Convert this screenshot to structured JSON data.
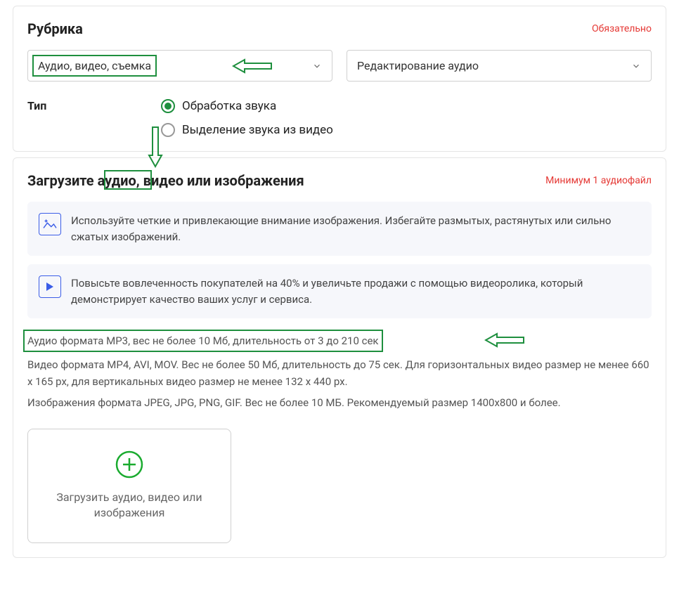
{
  "rubric": {
    "title": "Рубрика",
    "required_label": "Обязательно",
    "dropdown1": "Аудио, видео, съемка",
    "dropdown2": "Редактирование аудио"
  },
  "type": {
    "label": "Тип",
    "options": [
      "Обработка звука",
      "Выделение звука из видео"
    ],
    "selected": 0
  },
  "upload": {
    "title": "Загрузите аудио, видео или изображения",
    "min_label": "Минимум 1 аудиофайл",
    "info1": "Используйте четкие и привлекающие внимание изображения. Избегайте размытых, растянутых или сильно сжатых изображений.",
    "info2": "Повысьте вовлеченность покупателей на 40% и увеличьте продажи с помощью видеоролика, который демонстрирует качество ваших услуг и сервиса.",
    "spec_audio": "Аудио формата MP3, вес не более 10 Мб, длительность от 3 до 210 сек",
    "spec_video": "Видео формата MP4, AVI, MOV. Вес не более 50 Мб, длительность до 75 сек. Для горизонтальных видео размер не менее 660 х 165 px, для вертикальных видео размер не менее 132 х 440 px.",
    "spec_image": "Изображения формата JPEG, JPG, PNG, GIF. Вес не более 10 МБ. Рекомендуемый размер 1400х800 и более.",
    "upload_button": "Загрузить аудио, видео или изображения"
  }
}
